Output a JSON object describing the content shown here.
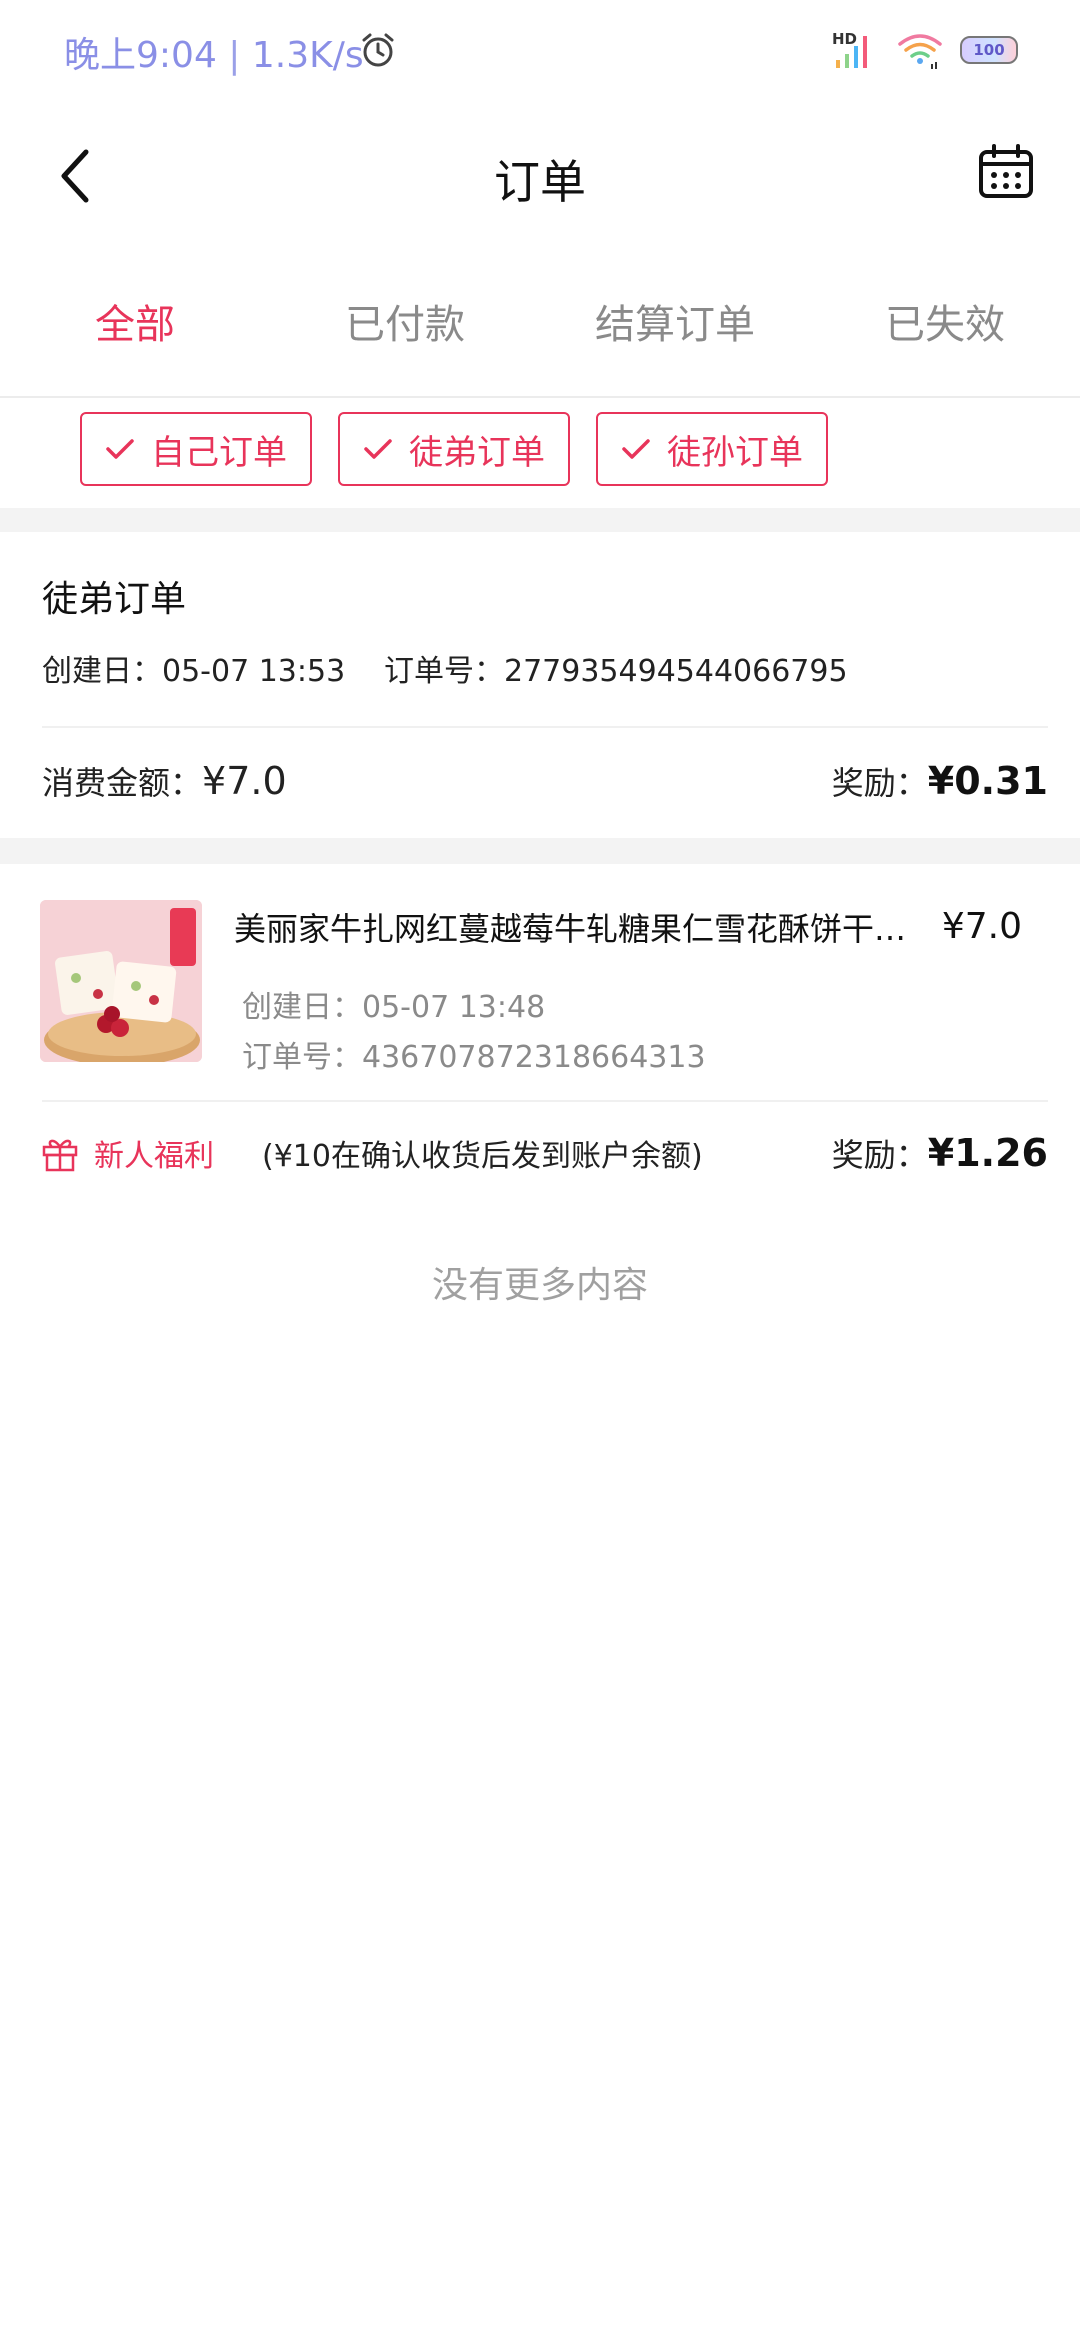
{
  "status_bar": {
    "time": "晚上9:04",
    "speed": "1.3K/s",
    "signal_label": "HD",
    "battery": "100"
  },
  "navbar": {
    "title": "订单",
    "back_icon": "back-icon",
    "calendar_icon": "calendar-icon"
  },
  "tabs": [
    {
      "label": "全部",
      "active": true
    },
    {
      "label": "已付款",
      "active": false
    },
    {
      "label": "结算订单",
      "active": false
    },
    {
      "label": "已失效",
      "active": false
    }
  ],
  "filters": [
    {
      "label": "自己订单",
      "checked": true
    },
    {
      "label": "徒弟订单",
      "checked": true
    },
    {
      "label": "徒孙订单",
      "checked": true
    }
  ],
  "order_card": {
    "type_label": "徒弟订单",
    "created_label": "创建日：",
    "created_value": "05-07 13:53",
    "order_no_label": "订单号：",
    "order_no_value": "2779354945440667​95",
    "spend_label": "消费金额：",
    "spend_value": "¥7.0",
    "reward_label": "奖励：",
    "reward_value": "¥0.31"
  },
  "product_card": {
    "name": "美丽家牛扎网红蔓越莓牛轧糖果仁雪花酥饼干零食",
    "price": "¥7.0",
    "created_label": "创建日：",
    "created_value": "05-07 13:48",
    "order_no_label": "订单号：",
    "order_no_value": "436707872318664313",
    "welfare_label": "新人福利",
    "welfare_note": "(¥10在确认收货后发到账户余额)",
    "reward_label": "奖励：",
    "reward_value": "¥1.26"
  },
  "footer_text": "没有更多内容",
  "colors": {
    "accent": "#e8345a",
    "muted": "#8a8a8a",
    "band": "#f3f3f3"
  }
}
